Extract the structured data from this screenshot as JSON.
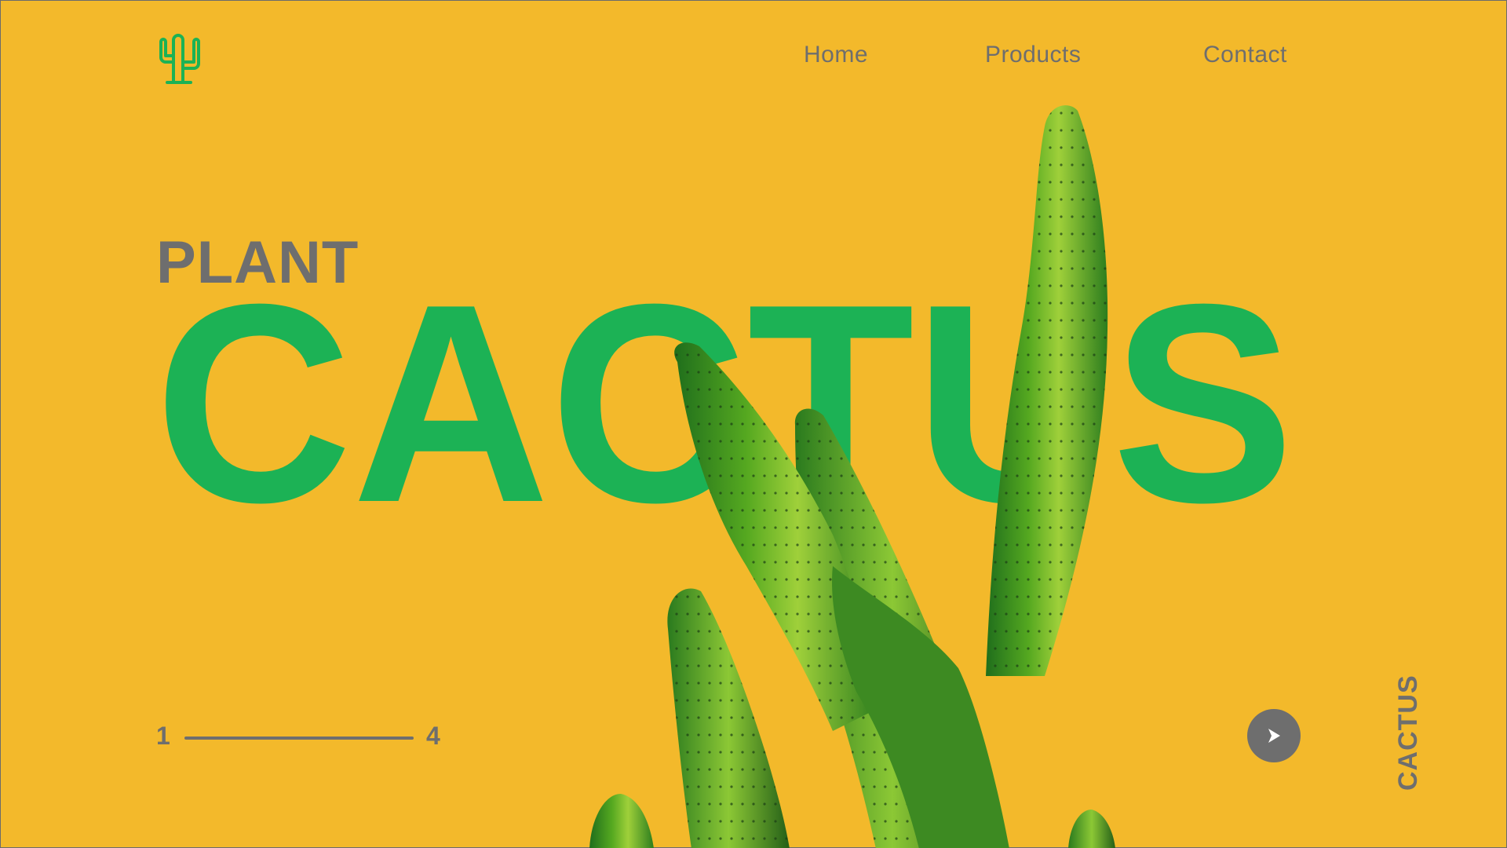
{
  "logo": {
    "icon": "cactus-logo-icon",
    "color": "#1cb255"
  },
  "nav": {
    "items": [
      {
        "label": "Home"
      },
      {
        "label": "Products"
      },
      {
        "label": "Contact"
      }
    ]
  },
  "hero": {
    "eyebrow": "PLANT",
    "word": "CACTUS",
    "word_color": "#1cb255"
  },
  "pager": {
    "start": "1",
    "end": "4"
  },
  "next_button": {
    "icon": "play-arrow-icon"
  },
  "side_label": "CACTUS",
  "colors": {
    "background": "#f3b92b",
    "text_gray": "#6e6e6e",
    "accent_green": "#1cb255"
  }
}
